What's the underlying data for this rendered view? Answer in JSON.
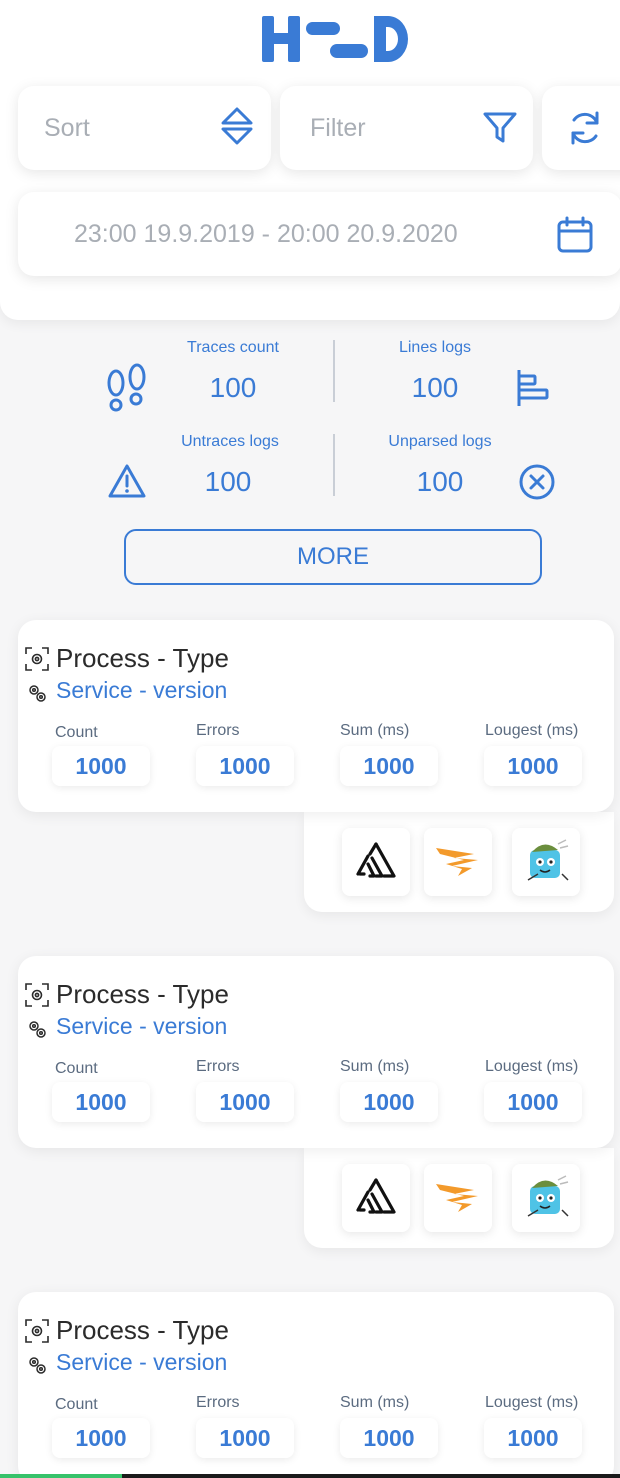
{
  "header": {
    "logo_text": "HOD",
    "sort_placeholder": "Sort",
    "filter_placeholder": "Filter",
    "date_range": "23:00 19.9.2019 - 20:00 20.9.2020"
  },
  "stats": {
    "traces_label": "Traces count",
    "traces_value": "100",
    "lines_label": "Lines logs",
    "lines_value": "100",
    "untraces_label": "Untraces logs",
    "untraces_value": "100",
    "unparsed_label": "Unparsed logs",
    "unparsed_value": "100",
    "more_label": "MORE"
  },
  "cards": [
    {
      "process": "Process - Type",
      "service": "Service - version",
      "metrics": [
        {
          "label": "Count",
          "value": "1000"
        },
        {
          "label": "Errors",
          "value": "1000"
        },
        {
          "label": "Sum (ms)",
          "value": "1000"
        },
        {
          "label": "Lougest (ms)",
          "value": "1000"
        }
      ]
    },
    {
      "process": "Process - Type",
      "service": "Service - version",
      "metrics": [
        {
          "label": "Count",
          "value": "1000"
        },
        {
          "label": "Errors",
          "value": "1000"
        },
        {
          "label": "Sum (ms)",
          "value": "1000"
        },
        {
          "label": "Lougest (ms)",
          "value": "1000"
        }
      ]
    },
    {
      "process": "Process - Type",
      "service": "Service - version",
      "metrics": [
        {
          "label": "Count",
          "value": "1000"
        },
        {
          "label": "Errors",
          "value": "1000"
        },
        {
          "label": "Sum (ms)",
          "value": "1000"
        },
        {
          "label": "Lougest (ms)",
          "value": "1000"
        }
      ]
    }
  ],
  "tools": [
    "sentry-icon",
    "solarwinds-icon",
    "mascot-icon"
  ],
  "colors": {
    "accent": "#3a7bd5",
    "text": "#2b2b2b",
    "muted": "#a9aeb5",
    "background": "#f6f6f7"
  }
}
